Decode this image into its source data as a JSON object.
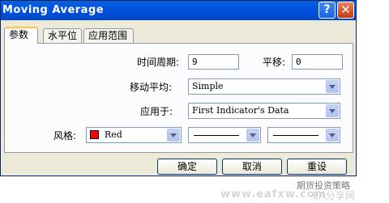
{
  "window": {
    "title": "Moving Average",
    "help_label": "?",
    "close_label": "✕"
  },
  "tabs": [
    {
      "label": "参数",
      "active": true
    },
    {
      "label": "水平位",
      "active": false
    },
    {
      "label": "应用范围",
      "active": false
    }
  ],
  "params": {
    "period_label": "时间周期:",
    "period_value": "9",
    "shift_label": "平移:",
    "shift_value": "0",
    "method_label": "移动平均:",
    "method_value": "Simple",
    "apply_label": "应用于:",
    "apply_value": "First Indicator's Data",
    "style_label": "风格:",
    "color_value": "Red",
    "color_hex": "#ff0000"
  },
  "buttons": {
    "ok": "确定",
    "cancel": "取消",
    "reset": "重设"
  },
  "watermark": {
    "line1": "期货投资策略",
    "line2": "www.eafxw.com",
    "line3": "EA分享网"
  }
}
